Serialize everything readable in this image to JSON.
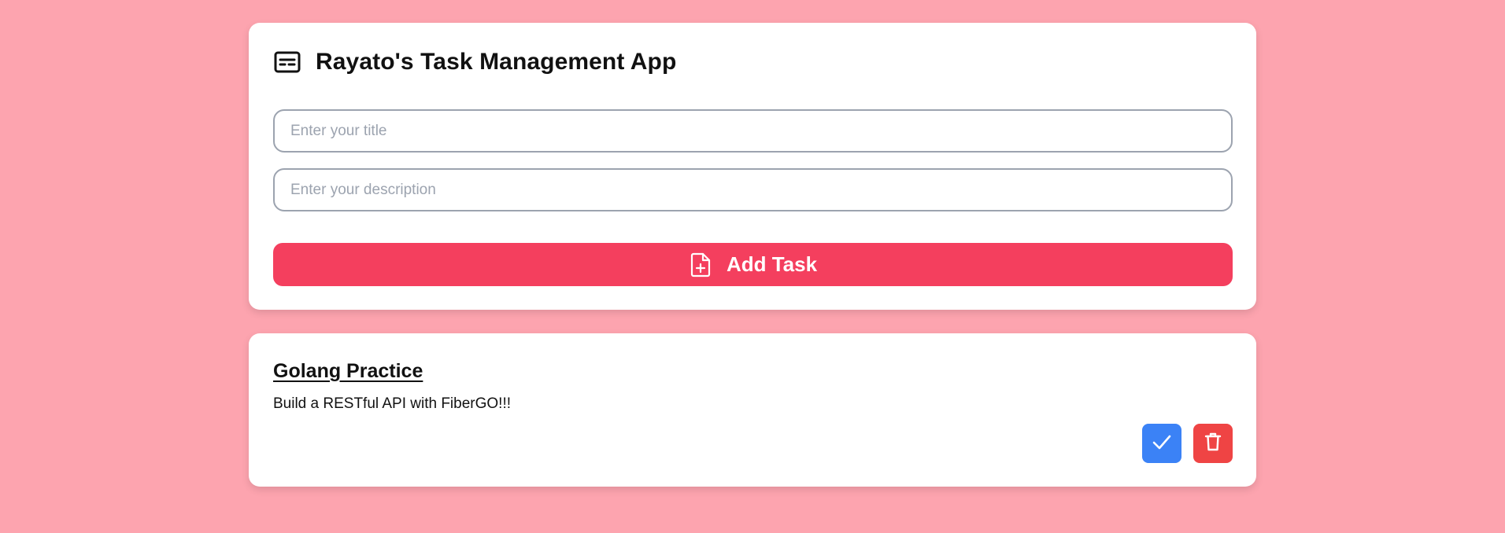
{
  "app": {
    "title": "Rayato's Task Management App",
    "icon": "card-list-icon"
  },
  "form": {
    "title_placeholder": "Enter your title",
    "title_value": "",
    "description_placeholder": "Enter your description",
    "description_value": "",
    "add_button_label": "Add Task",
    "add_button_icon": "file-plus-icon"
  },
  "tasks": [
    {
      "title": "Golang Practice",
      "description": "Build a RESTful API with FiberGO!!!",
      "complete_icon": "check-icon",
      "delete_icon": "trash-icon"
    }
  ],
  "colors": {
    "background": "#fda4af",
    "card": "#ffffff",
    "primary_button": "#f43f5e",
    "complete_button": "#3b82f6",
    "delete_button": "#ef4444",
    "input_border": "#9ca3af"
  }
}
